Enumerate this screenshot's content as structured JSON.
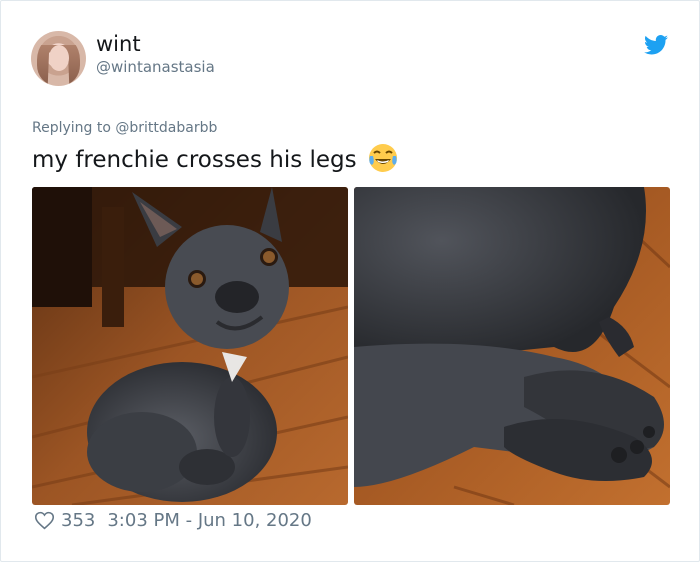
{
  "user": {
    "display_name": "wint",
    "handle": "@wintanastasia"
  },
  "reply": {
    "prefix": "Replying to ",
    "target": "@brittdabarbb"
  },
  "tweet": {
    "text": "my frenchie crosses his legs",
    "emoji": "face-with-tears-of-joy-emoji"
  },
  "footer": {
    "likes": "353",
    "timestamp": "3:03 PM - Jun 10, 2020"
  },
  "colors": {
    "twitter_blue": "#1da1f2",
    "secondary_text": "#657786",
    "primary_text": "#14171a"
  },
  "icons": [
    "twitter-bird-icon",
    "heart-icon"
  ]
}
